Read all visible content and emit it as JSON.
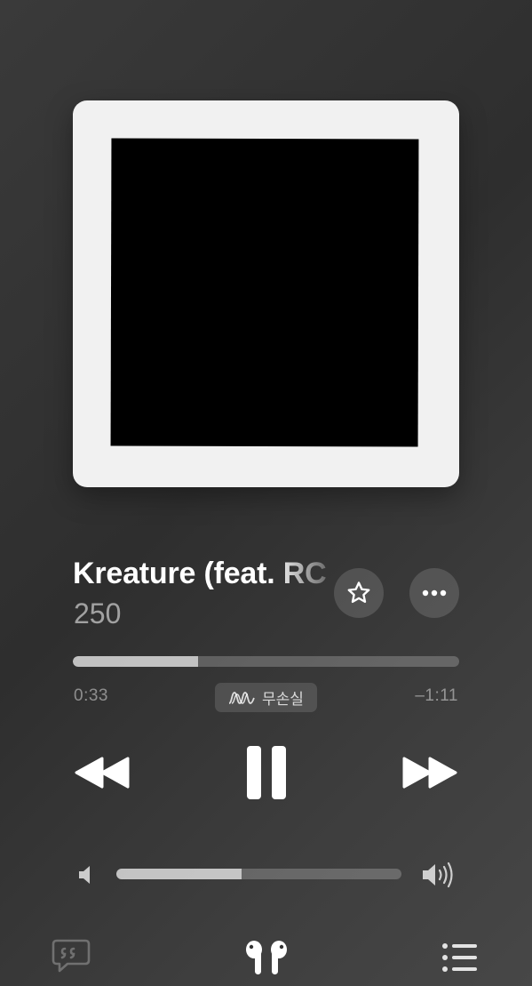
{
  "track": {
    "title": "Kreature (feat. RC",
    "artist": "250",
    "progress_fraction": 0.325
  },
  "playback": {
    "elapsed": "0:33",
    "remaining": "–1:11",
    "quality_badge": "무손실",
    "state": "playing"
  },
  "volume": {
    "level_fraction": 0.44
  },
  "icons": {
    "favorite": "star-icon",
    "more": "ellipsis-icon",
    "rewind": "rewind-icon",
    "pause": "pause-icon",
    "fast_forward": "fast-forward-icon",
    "volume_low": "speaker-low-icon",
    "volume_high": "speaker-high-icon",
    "lyrics": "lyrics-bubble-icon",
    "airplay": "airpods-icon",
    "queue": "list-icon",
    "lossless": "lossless-wave-icon"
  },
  "colors": {
    "background": "#333333",
    "artwork_frame": "#f1f1f1",
    "artwork_fill": "#000000",
    "text_primary": "#ffffff"
  }
}
